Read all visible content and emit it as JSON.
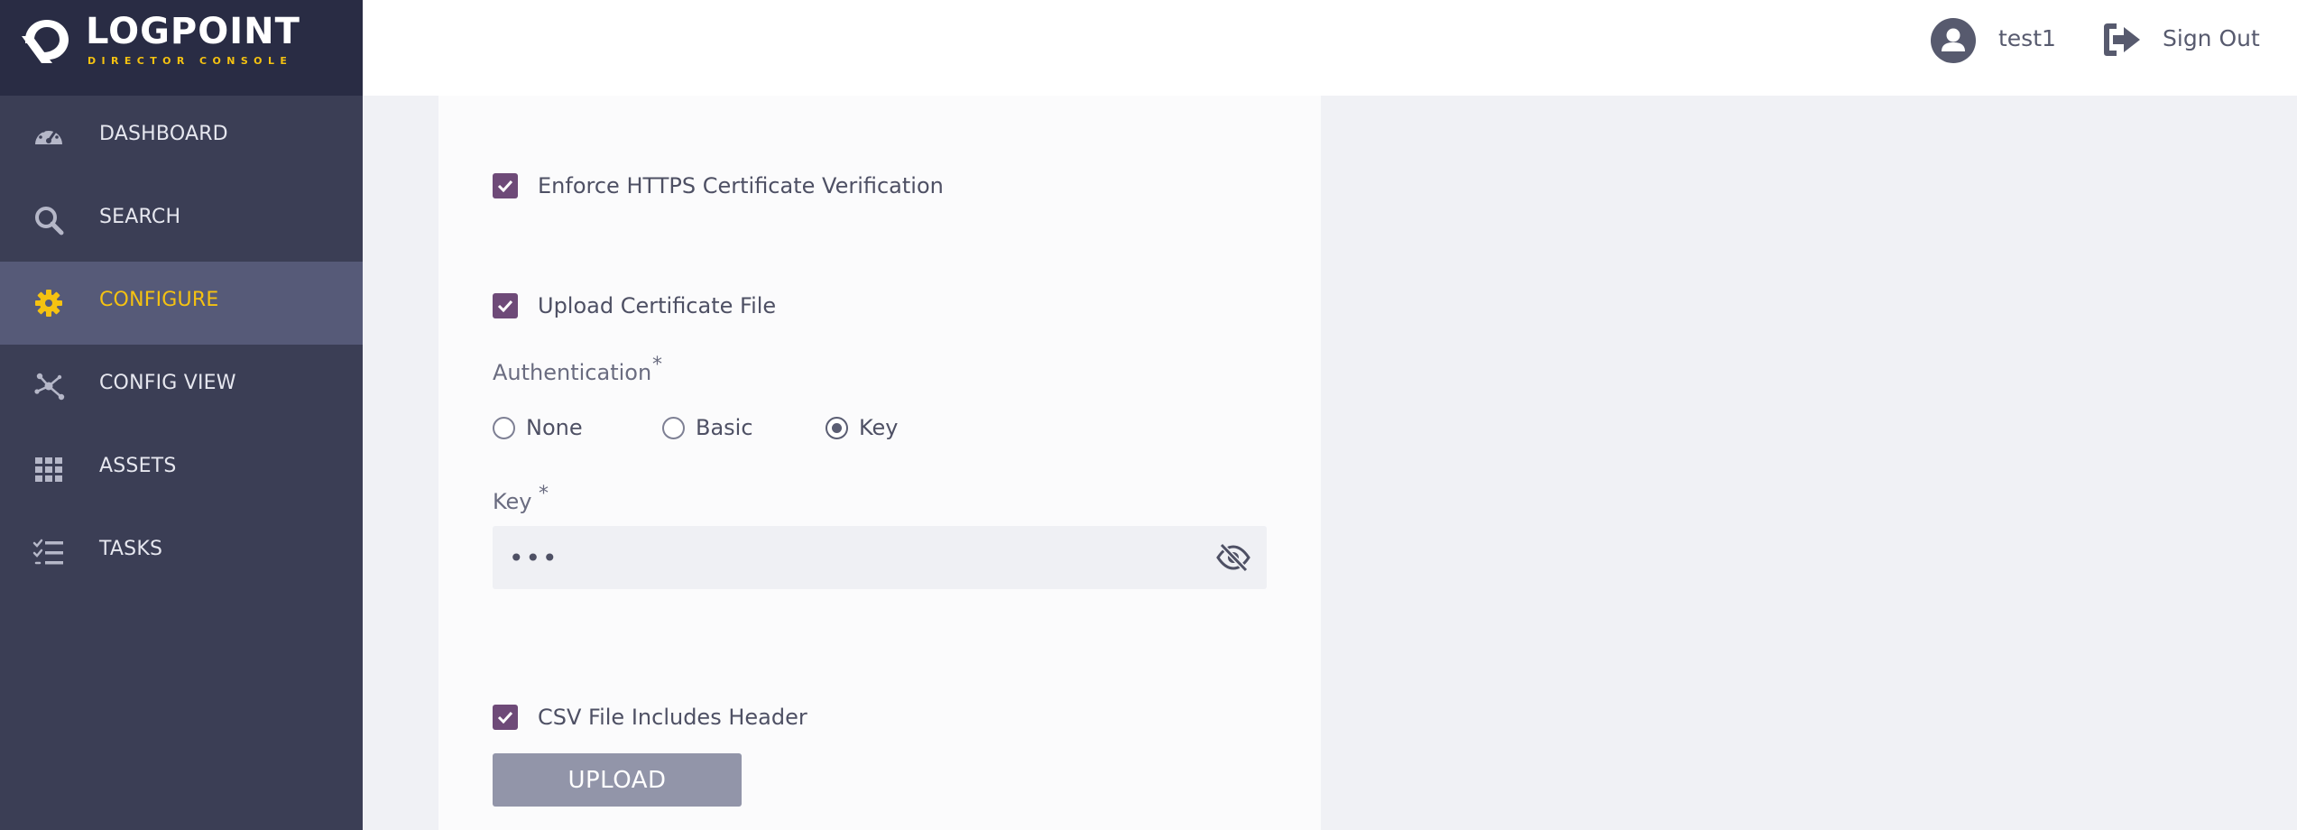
{
  "brand": {
    "name": "LOGPOINT",
    "subtitle": "DIRECTOR CONSOLE",
    "accent": "#f5c211"
  },
  "sidebar": {
    "items": [
      {
        "label": "DASHBOARD",
        "icon": "dashboard-gauge-icon"
      },
      {
        "label": "SEARCH",
        "icon": "search-icon"
      },
      {
        "label": "CONFIGURE",
        "icon": "gear-icon",
        "active": true
      },
      {
        "label": "CONFIG VIEW",
        "icon": "network-nodes-icon"
      },
      {
        "label": "ASSETS",
        "icon": "grid-icon"
      },
      {
        "label": "TASKS",
        "icon": "checklist-icon"
      }
    ]
  },
  "header": {
    "username": "test1",
    "signout_label": "Sign Out"
  },
  "form": {
    "enforce_https_label": "Enforce HTTPS Certificate Verification",
    "enforce_https_checked": true,
    "upload_cert_label": "Upload Certificate File",
    "upload_cert_checked": true,
    "auth_label": "Authentication",
    "required_mark": "*",
    "auth_options": [
      {
        "label": "None",
        "checked": false
      },
      {
        "label": "Basic",
        "checked": false
      },
      {
        "label": "Key",
        "checked": true
      }
    ],
    "key_label": "Key",
    "key_value": "•••",
    "csv_header_label": "CSV File Includes Header",
    "csv_header_checked": true,
    "upload_button": "UPLOAD"
  },
  "colors": {
    "sidebar_bg": "#3b3e55",
    "logo_bg": "#292c44",
    "active_item_bg": "#565a78",
    "checkbox": "#6e4a78",
    "button": "#9295a9"
  }
}
